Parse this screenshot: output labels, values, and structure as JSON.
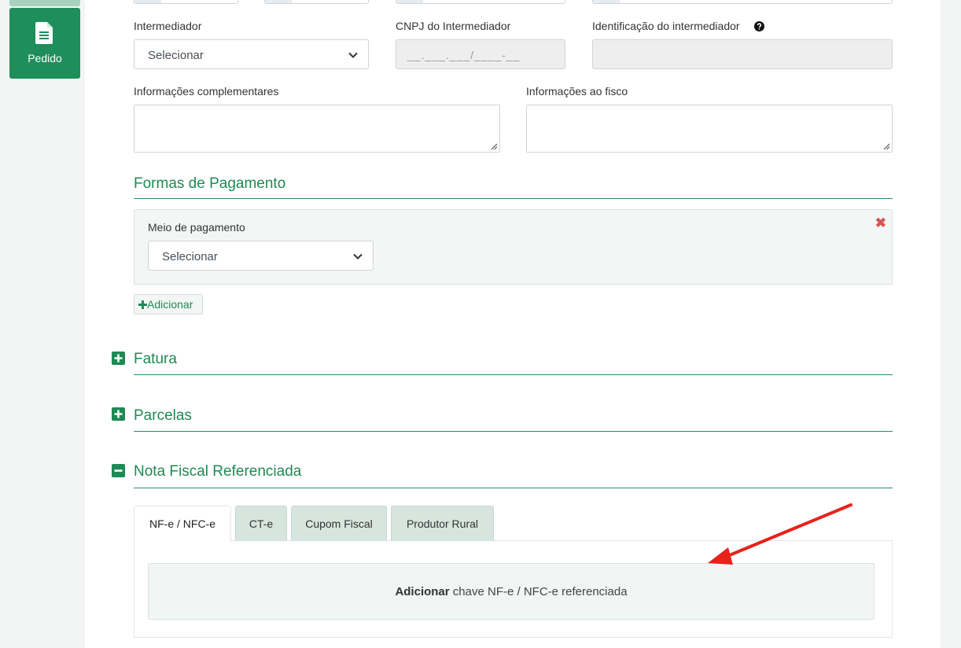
{
  "sidebar": {
    "pedido_label": "Pedido"
  },
  "form": {
    "intermediador": {
      "label": "Intermediador",
      "value": "Selecionar"
    },
    "cnpj_intermediador": {
      "label": "CNPJ do Intermediador",
      "placeholder": "__.___.___/____-__"
    },
    "identificacao_intermediador": {
      "label": "Identificação do intermediador",
      "value": ""
    },
    "info_complementares": {
      "label": "Informações complementares",
      "value": ""
    },
    "info_fisco": {
      "label": "Informações ao fisco",
      "value": ""
    }
  },
  "formas_pagamento": {
    "title": "Formas de Pagamento",
    "meio_label": "Meio de pagamento",
    "meio_value": "Selecionar",
    "add_label": "Adicionar"
  },
  "sections": {
    "fatura": "Fatura",
    "parcelas": "Parcelas",
    "nota_fiscal": "Nota Fiscal Referenciada"
  },
  "tabs": [
    {
      "label": "NF-e / NFC-e",
      "active": true
    },
    {
      "label": "CT-e",
      "active": false
    },
    {
      "label": "Cupom Fiscal",
      "active": false
    },
    {
      "label": "Produtor Rural",
      "active": false
    }
  ],
  "reference": {
    "action": "Adicionar",
    "text": " chave NF-e / NFC-e referenciada"
  },
  "colors": {
    "accent": "#1e8a55",
    "danger": "#d9534f",
    "annotation": "#e8221b"
  }
}
